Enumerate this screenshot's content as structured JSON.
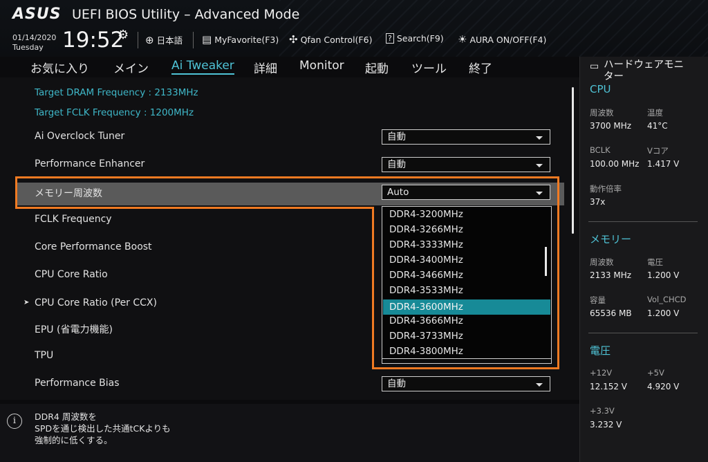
{
  "header": {
    "logo": "ASUS",
    "title": "UEFI BIOS Utility – Advanced Mode",
    "date": "01/14/2020",
    "day": "Tuesday",
    "time": "19:52",
    "items": [
      {
        "label": "日本語",
        "icon": "globe-icon"
      },
      {
        "label": "MyFavorite(F3)",
        "icon": "favorite-icon"
      },
      {
        "label": "Qfan Control(F6)",
        "icon": "fan-icon"
      },
      {
        "label": "Search(F9)",
        "icon": "search-icon"
      },
      {
        "label": "AURA ON/OFF(F4)",
        "icon": "aura-icon"
      }
    ]
  },
  "nav": {
    "tabs": [
      "お気に入り",
      "メイン",
      "Ai Tweaker",
      "詳細",
      "Monitor",
      "起動",
      "ツール",
      "終了"
    ],
    "active": "Ai Tweaker"
  },
  "main": {
    "info": [
      "Target DRAM Frequency : 2133MHz",
      "Target FCLK Frequency : 1200MHz"
    ],
    "rows": [
      {
        "label": "Ai Overclock Tuner",
        "value": "自動"
      },
      {
        "label": "Performance Enhancer",
        "value": "自動"
      },
      {
        "label": "メモリー周波数",
        "value": "Auto"
      },
      {
        "label": "FCLK Frequency"
      },
      {
        "label": "Core Performance Boost"
      },
      {
        "label": "CPU Core Ratio"
      },
      {
        "label": "CPU Core Ratio (Per CCX)"
      },
      {
        "label": "EPU (省電力機能)"
      },
      {
        "label": "TPU"
      },
      {
        "label": "Performance Bias",
        "value": "自動"
      }
    ],
    "submenu_marker": "➤",
    "dropdown_options": [
      "DDR4-3200MHz",
      "DDR4-3266MHz",
      "DDR4-3333MHz",
      "DDR4-3400MHz",
      "DDR4-3466MHz",
      "DDR4-3533MHz",
      "DDR4-3600MHz",
      "DDR4-3666MHz",
      "DDR4-3733MHz",
      "DDR4-3800MHz"
    ],
    "dropdown_selected": "DDR4-3600MHz"
  },
  "help": {
    "text": "DDR4 周波数を\nSPDを通じ検出した共通tCKよりも\n強制的に低くする。"
  },
  "hw": {
    "title": "ハードウェアモニ\nター",
    "cpu": {
      "heading": "CPU",
      "freq_label": "周波数",
      "freq": "3700 MHz",
      "temp_label": "温度",
      "temp": "41°C",
      "bclk_label": "BCLK",
      "bclk": "100.00 MHz",
      "vcore_label": "Vコア",
      "vcore": "1.417 V",
      "ratio_label": "動作倍率",
      "ratio": "37x"
    },
    "memory": {
      "heading": "メモリー",
      "freq_label": "周波数",
      "freq": "2133 MHz",
      "volt_label": "電圧",
      "volt": "1.200 V",
      "cap_label": "容量",
      "cap": "65536 MB",
      "chcd_label": "Vol_CHCD",
      "chcd": "1.200 V"
    },
    "voltage": {
      "heading": "電圧",
      "v12_label": "+12V",
      "v12": "12.152 V",
      "v5_label": "+5V",
      "v5": "4.920 V",
      "v33_label": "+3.3V",
      "v33": "3.232 V"
    }
  },
  "colors": {
    "accent": "#4fc3d6",
    "highlight": "#178a97",
    "annotation": "#f07a22"
  }
}
